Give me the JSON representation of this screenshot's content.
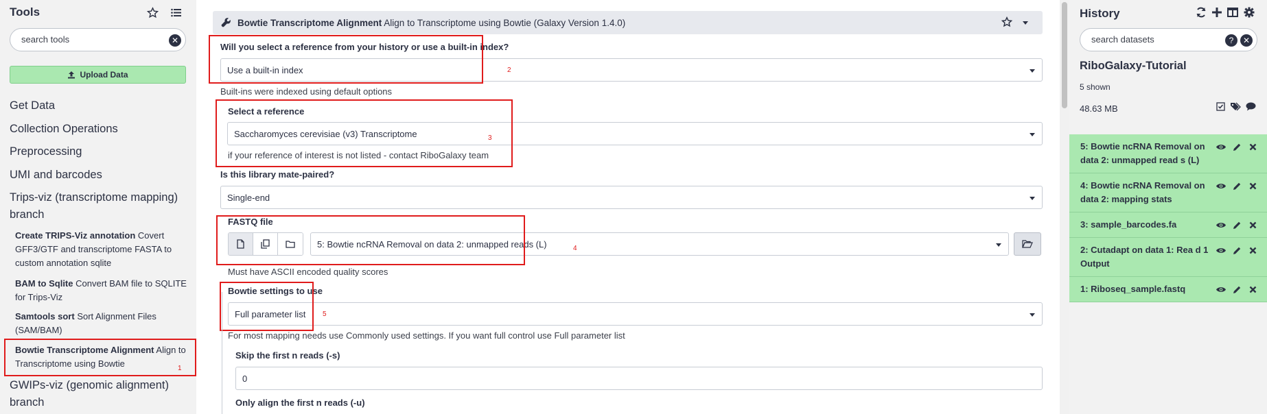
{
  "tool_panel": {
    "title": "Tools",
    "search_placeholder": "search tools",
    "upload_label": "Upload Data",
    "sections": [
      "Get Data",
      "Collection Operations",
      "Preprocessing",
      "UMI and barcodes",
      "Trips-viz (transcriptome mapping) branch",
      "GWIPs-viz (genomic alignment) branch"
    ],
    "tools": [
      {
        "name": "Create TRIPS-Viz annotation",
        "desc": "Covert GFF3/GTF and transcriptome FASTA to custom annotation sqlite"
      },
      {
        "name": "BAM to Sqlite",
        "desc": "Convert BAM file to SQLITE for Trips-Viz"
      },
      {
        "name": "Samtools sort",
        "desc": "Sort Alignment Files (SAM/BAM)"
      },
      {
        "name": "Bowtie Transcriptome Alignment",
        "desc": "Align to Transcriptome using Bowtie"
      }
    ]
  },
  "form": {
    "tool_name": "Bowtie Transcriptome Alignment",
    "tool_desc": "Align to Transcriptome using Bowtie (Galaxy Version 1.4.0)",
    "ref_source_label": "Will you select a reference from your history or use a built-in index?",
    "ref_source_value": "Use a built-in index",
    "ref_source_help": "Built-ins were indexed using default options",
    "reference_label": "Select a reference",
    "reference_value": "Saccharomyces cerevisiae (v3) Transcriptome",
    "reference_help": "if your reference of interest is not listed - contact RiboGalaxy team",
    "paired_label": "Is this library mate-paired?",
    "paired_value": "Single-end",
    "fastq_label": "FASTQ file",
    "fastq_value": "5: Bowtie ncRNA Removal on data 2: unmapped reads (L)",
    "fastq_help": "Must have ASCII encoded quality scores",
    "settings_label": "Bowtie settings to use",
    "settings_value": "Full parameter list",
    "settings_help": "For most mapping needs use Commonly used settings. If you want full control use Full parameter list",
    "skip_label": "Skip the first n reads (-s)",
    "skip_value": "0",
    "align_label": "Only align the first n reads (-u)"
  },
  "annotations": [
    "1",
    "2",
    "3",
    "4",
    "5"
  ],
  "history": {
    "title": "History",
    "search_placeholder": "search datasets",
    "name": "RiboGalaxy-Tutorial",
    "shown": "5 shown",
    "size": "48.63 MB",
    "items": [
      "5: Bowtie ncRNA Removal on data 2: unmapped read s (L)",
      "4: Bowtie ncRNA Removal on data 2: mapping stats",
      "3: sample_barcodes.fa",
      "2: Cutadapt on data 1: Rea d 1 Output",
      "1: Riboseq_sample.fastq"
    ]
  },
  "colors": {
    "accent_green": "#aae8b0",
    "annotation_red": "#e01b1b",
    "header_gray": "#e7e9ee"
  }
}
